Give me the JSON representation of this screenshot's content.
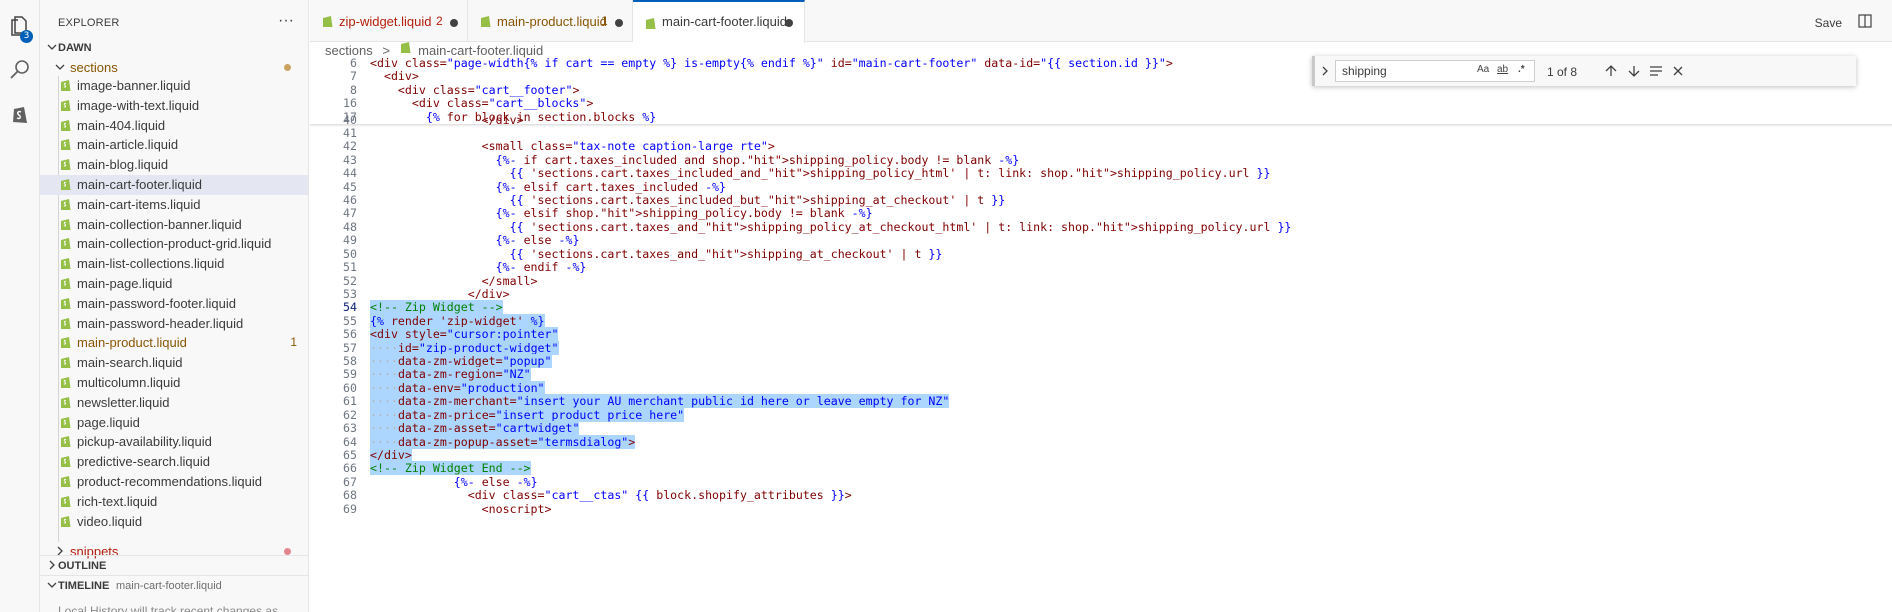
{
  "activity": {
    "badge": "3"
  },
  "explorer": {
    "title": "EXPLORER",
    "more": "···",
    "workspace": "DAWN",
    "folder": "sections",
    "snippets": "snippets",
    "files": [
      {
        "name": "image-banner.liquid"
      },
      {
        "name": "image-with-text.liquid"
      },
      {
        "name": "main-404.liquid"
      },
      {
        "name": "main-article.liquid"
      },
      {
        "name": "main-blog.liquid"
      },
      {
        "name": "main-cart-footer.liquid"
      },
      {
        "name": "main-cart-items.liquid"
      },
      {
        "name": "main-collection-banner.liquid"
      },
      {
        "name": "main-collection-product-grid.liquid"
      },
      {
        "name": "main-list-collections.liquid"
      },
      {
        "name": "main-page.liquid"
      },
      {
        "name": "main-password-footer.liquid"
      },
      {
        "name": "main-password-header.liquid"
      },
      {
        "name": "main-product.liquid",
        "badge": "1"
      },
      {
        "name": "main-search.liquid"
      },
      {
        "name": "multicolumn.liquid"
      },
      {
        "name": "newsletter.liquid"
      },
      {
        "name": "page.liquid"
      },
      {
        "name": "pickup-availability.liquid"
      },
      {
        "name": "predictive-search.liquid"
      },
      {
        "name": "product-recommendations.liquid"
      },
      {
        "name": "rich-text.liquid"
      },
      {
        "name": "video.liquid"
      }
    ],
    "outline": "OUTLINE",
    "timeline": "TIMELINE",
    "timeline_file": "main-cart-footer.liquid",
    "history_text": "Local History will track recent changes as"
  },
  "tabs": [
    {
      "name": "zip-widget.liquid",
      "count": "2"
    },
    {
      "name": "main-product.liquid",
      "count": "1"
    },
    {
      "name": "main-cart-footer.liquid"
    }
  ],
  "toolbar": {
    "save": "Save"
  },
  "breadcrumb": {
    "folder": "sections",
    "sep": ">",
    "file": "main-cart-footer.liquid"
  },
  "find": {
    "query": "shipping",
    "case": "Aa",
    "word": "ab",
    "regex": ".*",
    "result": "1 of 8"
  },
  "code": {
    "sticky": [
      {
        "n": "6",
        "text": "<div class=\"page-width{% if cart == empty %} is-empty{% endif %}\" id=\"main-cart-footer\" data-id=\"{{ section.id }}\">"
      },
      {
        "n": "7",
        "text": "  <div>"
      },
      {
        "n": "8",
        "text": "    <div class=\"cart__footer\">"
      },
      {
        "n": "16",
        "text": "      <div class=\"cart__blocks\">"
      },
      {
        "n": "17",
        "text": "        {% for block in section.blocks %}"
      }
    ],
    "lines": [
      {
        "n": "40",
        "text": "                </div>"
      },
      {
        "n": "41",
        "text": ""
      },
      {
        "n": "42",
        "text": "                <small class=\"tax-note caption-large rte\">"
      },
      {
        "n": "43",
        "text": "                  {%- if cart.taxes_included and shop.shipping_policy.body != blank -%}"
      },
      {
        "n": "44",
        "text": "                    {{ 'sections.cart.taxes_included_and_shipping_policy_html' | t: link: shop.shipping_policy.url }}"
      },
      {
        "n": "45",
        "text": "                  {%- elsif cart.taxes_included -%}"
      },
      {
        "n": "46",
        "text": "                    {{ 'sections.cart.taxes_included_but_shipping_at_checkout' | t }}"
      },
      {
        "n": "47",
        "text": "                  {%- elsif shop.shipping_policy.body != blank -%}"
      },
      {
        "n": "48",
        "text": "                    {{ 'sections.cart.taxes_and_shipping_policy_at_checkout_html' | t: link: shop.shipping_policy.url }}"
      },
      {
        "n": "49",
        "text": "                  {%- else -%}"
      },
      {
        "n": "50",
        "text": "                    {{ 'sections.cart.taxes_and_shipping_at_checkout' | t }}"
      },
      {
        "n": "51",
        "text": "                  {%- endif -%}"
      },
      {
        "n": "52",
        "text": "                </small>"
      },
      {
        "n": "53",
        "text": "              </div>"
      },
      {
        "n": "54",
        "text": "<!-- Zip Widget -->"
      },
      {
        "n": "55",
        "text": "{% render 'zip-widget' %}"
      },
      {
        "n": "56",
        "text": "<div style=\"cursor:pointer\""
      },
      {
        "n": "57",
        "text": "····id=\"zip-product-widget\""
      },
      {
        "n": "58",
        "text": "····data-zm-widget=\"popup\""
      },
      {
        "n": "59",
        "text": "····data-zm-region=\"NZ\""
      },
      {
        "n": "60",
        "text": "····data-env=\"production\""
      },
      {
        "n": "61",
        "text": "····data-zm-merchant=\"insert your AU merchant public id here or leave empty for NZ\""
      },
      {
        "n": "62",
        "text": "····data-zm-price=\"insert product price here\""
      },
      {
        "n": "63",
        "text": "····data-zm-asset=\"cartwidget\""
      },
      {
        "n": "64",
        "text": "····data-zm-popup-asset=\"termsdialog\">"
      },
      {
        "n": "65",
        "text": "</div>"
      },
      {
        "n": "66",
        "text": "<!-- Zip Widget End -->"
      },
      {
        "n": "67",
        "text": "            {%- else -%}"
      },
      {
        "n": "68",
        "text": "              <div class=\"cart__ctas\" {{ block.shopify_attributes }}>"
      },
      {
        "n": "69",
        "text": "                <noscript>"
      }
    ]
  }
}
